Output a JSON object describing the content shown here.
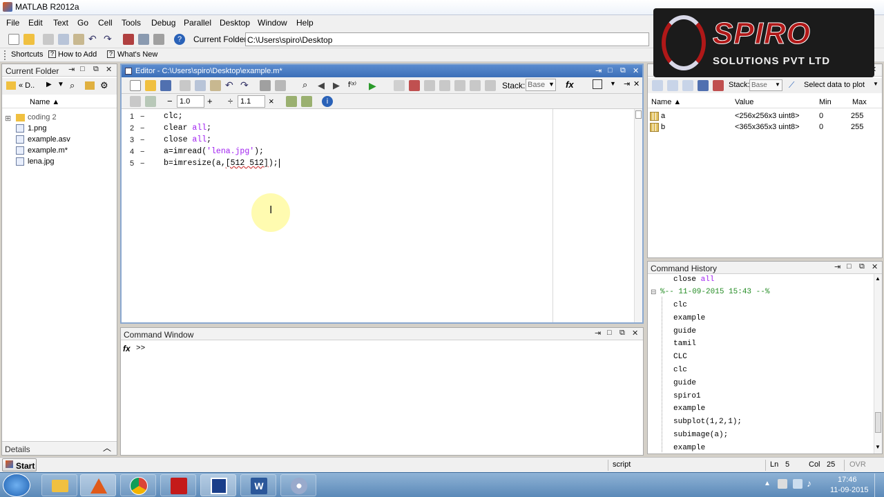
{
  "window": {
    "title": "MATLAB  R2012a"
  },
  "menu": [
    "File",
    "Edit",
    "Text",
    "Go",
    "Cell",
    "Tools",
    "Debug",
    "Parallel",
    "Desktop",
    "Window",
    "Help"
  ],
  "toolbar": {
    "current_folder_label": "Current Folder:",
    "current_folder_value": "C:\\Users\\spiro\\Desktop"
  },
  "shortcuts": {
    "shortcuts": "Shortcuts",
    "how_to_add": "How to Add",
    "whats_new": "What's New"
  },
  "current_folder": {
    "title": "Current Folder",
    "path": "« D..",
    "column": "Name ▲",
    "items": [
      {
        "name": "coding 2",
        "type": "folder"
      },
      {
        "name": "1.png",
        "type": "file"
      },
      {
        "name": "example.asv",
        "type": "file"
      },
      {
        "name": "example.m*",
        "type": "file"
      },
      {
        "name": "lena.jpg",
        "type": "file"
      }
    ],
    "details": "Details"
  },
  "editor": {
    "title": "Editor - C:\\Users\\spiro\\Desktop\\example.m*",
    "cell_minus": "−",
    "cell_value_1": "1.0",
    "cell_plus": "+",
    "cell_div": "÷",
    "cell_value_2": "1.1",
    "cell_times": "×",
    "stack_label": "Stack:",
    "stack_value": "Base",
    "lines": [
      {
        "num": "1",
        "dash": "−",
        "code": "clc;"
      },
      {
        "num": "2",
        "dash": "−",
        "code": "clear ",
        "arg": "all",
        "end": ";"
      },
      {
        "num": "3",
        "dash": "−",
        "code": "close ",
        "arg": "all",
        "end": ";"
      },
      {
        "num": "4",
        "dash": "−",
        "code": "a=imread(",
        "arg": "'lena.jpg'",
        "end": ");"
      },
      {
        "num": "5",
        "dash": "−",
        "code": "b=imresize(a,",
        "arg": "[512 512]",
        "end": ");"
      }
    ]
  },
  "workspace": {
    "stack_label": "Stack:",
    "stack_value": "Base",
    "select_plot": "Select data to plot",
    "columns": [
      "Name ▲",
      "Value",
      "Min",
      "Max"
    ],
    "rows": [
      {
        "name": "a",
        "value": "<256x256x3 uint8>",
        "min": "0",
        "max": "255"
      },
      {
        "name": "b",
        "value": "<365x365x3 uint8>",
        "min": "0",
        "max": "255"
      }
    ]
  },
  "command_window": {
    "title": "Command Window",
    "prompt": ">>",
    "fx": "fx"
  },
  "history": {
    "title": "Command History",
    "items": [
      {
        "text": "close ",
        "arg": "all",
        "kind": "cmd"
      },
      {
        "text": "%-- 11-09-2015 15:43 --%",
        "kind": "session"
      },
      {
        "text": "clc",
        "kind": "cmd"
      },
      {
        "text": "example",
        "kind": "cmd"
      },
      {
        "text": "guide",
        "kind": "cmd"
      },
      {
        "text": "tamil",
        "kind": "cmd"
      },
      {
        "text": "CLC",
        "kind": "cmd"
      },
      {
        "text": "clc",
        "kind": "cmd"
      },
      {
        "text": "guide",
        "kind": "cmd"
      },
      {
        "text": "spiro1",
        "kind": "cmd"
      },
      {
        "text": "example",
        "kind": "cmd"
      },
      {
        "text": "subplot(1,2,1);",
        "kind": "cmd"
      },
      {
        "text": "subimage(a);",
        "kind": "cmd"
      },
      {
        "text": "example",
        "kind": "cmd"
      }
    ]
  },
  "status": {
    "start": "Start",
    "mode": "script",
    "ln_label": "Ln",
    "ln": "5",
    "col_label": "Col",
    "col": "25",
    "ovr": "OVR"
  },
  "clock": {
    "time": "17:46",
    "date": "11-09-2015"
  },
  "logo": {
    "brand": "SPIRO",
    "sub": "SOLUTIONS PVT LTD"
  },
  "colors": {
    "accent": "#3c78c8",
    "string": "#a020f0",
    "session": "#228b22"
  }
}
